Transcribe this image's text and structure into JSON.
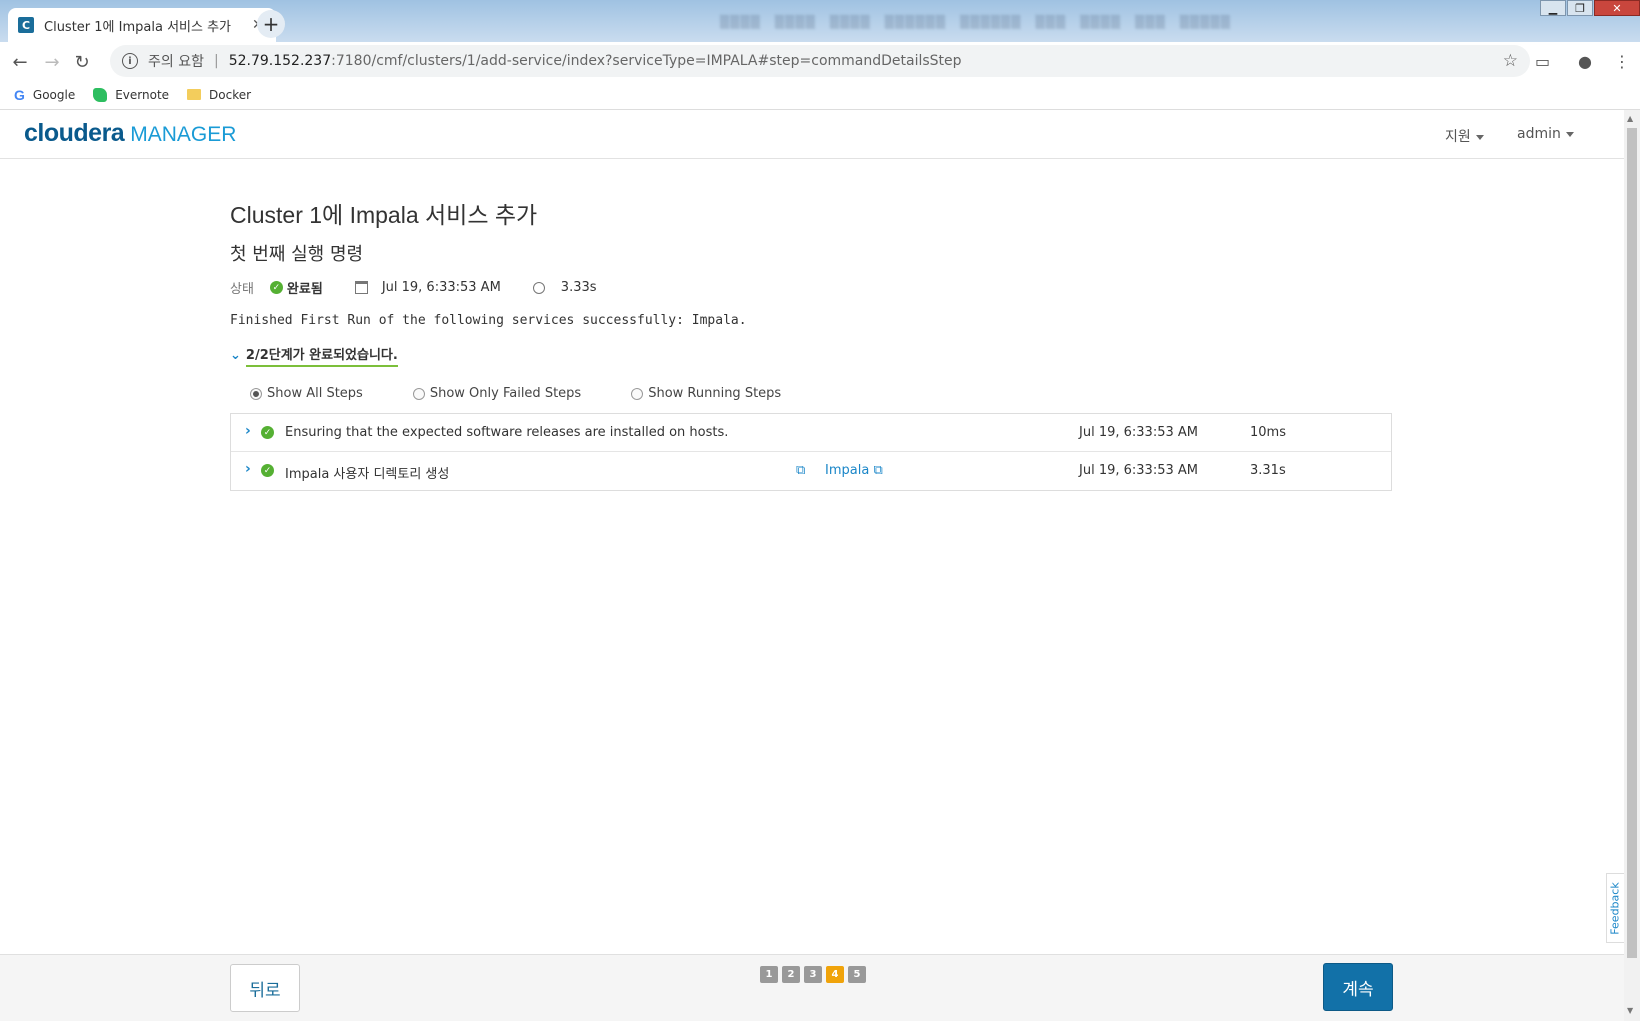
{
  "browser": {
    "tab_title": "Cluster 1에 Impala 서비스 추가",
    "new_tab_symbol": "+",
    "security_label": "주의 요함",
    "url_host": "52.79.152.237",
    "url_path": ":7180/cmf/clusters/1/add-service/index?serviceType=IMPALA#step=commandDetailsStep",
    "bookmarks": [
      {
        "label": "Google",
        "icon": "google-icon"
      },
      {
        "label": "Evernote",
        "icon": "evernote-icon"
      },
      {
        "label": "Docker",
        "icon": "folder-icon"
      }
    ]
  },
  "header": {
    "logo_primary": "cloudera",
    "logo_secondary": "MANAGER",
    "support_menu": "지원",
    "user_menu": "admin"
  },
  "main": {
    "title": "Cluster 1에 Impala 서비스 추가",
    "subtitle": "첫 번째 실행 명령",
    "status_label": "상태",
    "status_value": "완료됨",
    "start_time": "Jul 19, 6:33:53 AM",
    "duration": "3.33s",
    "message": "Finished First Run of the following services successfully: Impala.",
    "steps_summary": "2/2단계가 완료되었습니다.",
    "filters": [
      {
        "label": "Show All Steps",
        "selected": true
      },
      {
        "label": "Show Only Failed Steps",
        "selected": false
      },
      {
        "label": "Show Running Steps",
        "selected": false
      }
    ],
    "steps": [
      {
        "description": "Ensuring that the expected software releases are installed on hosts.",
        "link": "",
        "time": "Jul 19, 6:33:53 AM",
        "duration": "10ms",
        "status": "success"
      },
      {
        "description": "Impala 사용자 디렉토리 생성",
        "link": "Impala",
        "time": "Jul 19, 6:33:53 AM",
        "duration": "3.31s",
        "status": "success"
      }
    ]
  },
  "footer": {
    "back_label": "뒤로",
    "continue_label": "계속",
    "pages": [
      "1",
      "2",
      "3",
      "4",
      "5"
    ],
    "current_page": "4"
  },
  "feedback_label": "Feedback",
  "colors": {
    "brand": "#0a5a8c",
    "accent": "#1a86c8",
    "success": "#55b033",
    "active_page": "#f0a30a",
    "primary_button": "#1271a8"
  }
}
